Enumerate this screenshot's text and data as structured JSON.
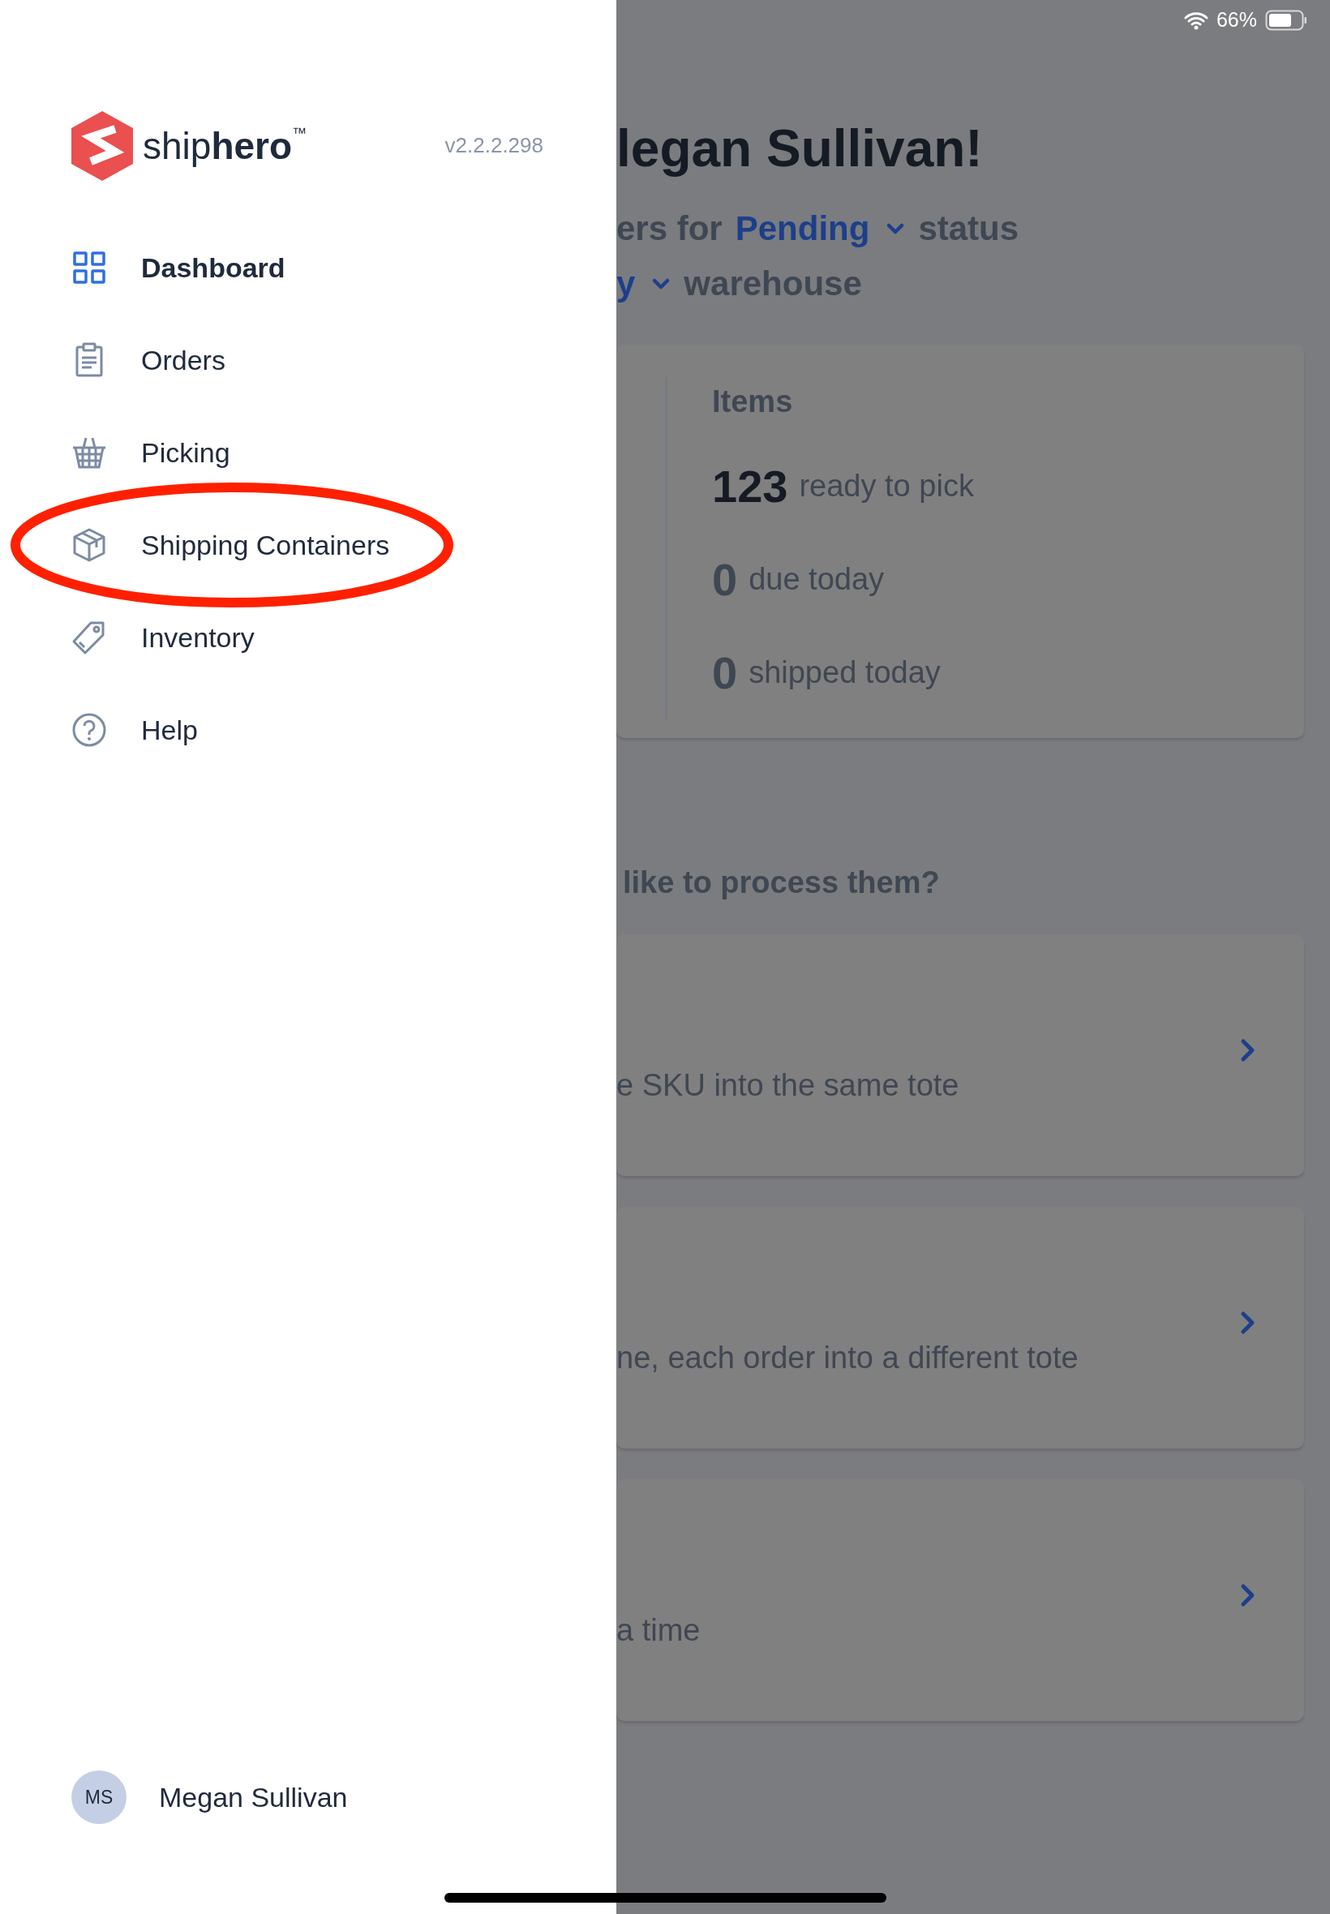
{
  "status_bar": {
    "battery_percent": "66%"
  },
  "drawer": {
    "brand": "ship**hero**$^{™}$",
    "version": "v2.2.2.298",
    "menu": [
      {
        "label": "Dashboard",
        "kind": "grid",
        "selected": true,
        "circled": false
      },
      {
        "label": "Orders",
        "kind": "clipboard",
        "selected": false,
        "circled": false
      },
      {
        "label": "Picking",
        "kind": "basket",
        "selected": false,
        "circled": false
      },
      {
        "label": "Shipping Containers",
        "kind": "box",
        "selected": false,
        "circled": true
      },
      {
        "label": "Inventory",
        "kind": "tag",
        "selected": false,
        "circled": false
      },
      {
        "label": "Help",
        "kind": "help",
        "selected": false,
        "circled": false
      }
    ],
    "user": {
      "initials": "MS",
      "name": "Megan Sullivan"
    }
  },
  "main": {
    "greeting": "legan Sullivan!",
    "filter_lines": [
      [
        {
          "kind": "text",
          "text": "ers for"
        },
        {
          "kind": "dropdown",
          "text": "Pending"
        },
        {
          "kind": "text",
          "text": "status"
        }
      ],
      [
        {
          "kind": "dropdown",
          "text": "y"
        },
        {
          "kind": "text",
          "text": "warehouse"
        }
      ]
    ],
    "stats": {
      "title": "Items",
      "rows": [
        {
          "count": "123",
          "label": "ready to pick",
          "highlighted": true
        },
        {
          "count": "0",
          "label": "due today",
          "highlighted": false
        },
        {
          "count": "0",
          "label": "shipped today",
          "highlighted": false
        }
      ]
    },
    "question": "like to process them?",
    "options": [
      {
        "description": "e SKU into the same tote"
      },
      {
        "description": "ne, each order into a different tote"
      },
      {
        "description": "a time"
      }
    ]
  }
}
